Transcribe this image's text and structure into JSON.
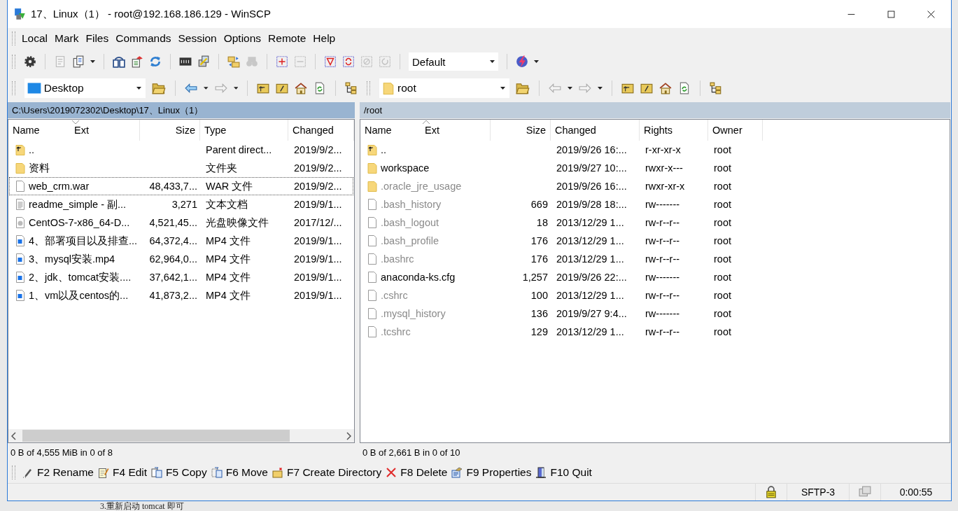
{
  "window": {
    "title": "17、Linux（1） - root@192.168.186.129 - WinSCP"
  },
  "menu": [
    "Local",
    "Mark",
    "Files",
    "Commands",
    "Session",
    "Options",
    "Remote",
    "Help"
  ],
  "toolbar": {
    "buttons": [
      {
        "kind": "gear",
        "disabled": false
      },
      {
        "kind": "notes",
        "disabled": true
      },
      {
        "kind": "clipboard",
        "disabled": false
      },
      {
        "kind": "compare",
        "disabled": false
      },
      {
        "kind": "synchronize",
        "disabled": false
      },
      {
        "kind": "refresh",
        "disabled": false
      },
      {
        "kind": "console",
        "disabled": false
      },
      {
        "kind": "putty",
        "disabled": false
      },
      {
        "kind": "explore",
        "disabled": false
      },
      {
        "kind": "find",
        "disabled": true
      },
      {
        "kind": "select",
        "disabled": false
      },
      {
        "kind": "unselect",
        "disabled": true
      },
      {
        "kind": "filter",
        "disabled": false
      },
      {
        "kind": "invert",
        "disabled": false
      },
      {
        "kind": "clear",
        "disabled": true
      },
      {
        "kind": "restore",
        "disabled": true
      }
    ],
    "transfer_preset": "Default"
  },
  "left_panel": {
    "location": {
      "label": "Desktop",
      "kind": "desktop"
    },
    "back_enabled": true,
    "active": true,
    "path": "C:\\Users\\2019072302\\Desktop\\17、Linux（1）",
    "columns": [
      {
        "label": "Name"
      },
      {
        "label": "Ext",
        "sort_ascending": false
      },
      {
        "label": "Size"
      },
      {
        "label": "Type"
      },
      {
        "label": "Changed"
      }
    ],
    "rows": [
      {
        "kind": "parent",
        "name": "..",
        "type": "Parent direct...",
        "changed": "2019/9/2...",
        "focused": false
      },
      {
        "kind": "folder",
        "name": "资料",
        "type": "文件夹",
        "changed": "2019/9/2...",
        "focused": false
      },
      {
        "kind": "file",
        "name": "web_crm.war",
        "size": "48,433,7...",
        "type": "WAR 文件",
        "changed": "2019/9/2...",
        "focused": true
      },
      {
        "kind": "text",
        "name": "readme_simple - 副...",
        "size": "3,271",
        "type": "文本文档",
        "changed": "2019/9/1...",
        "focused": false
      },
      {
        "kind": "disc",
        "name": "CentOS-7-x86_64-D...",
        "size": "4,521,45...",
        "type": "光盘映像文件",
        "changed": "2017/12/...",
        "focused": false
      },
      {
        "kind": "video",
        "name": "4、部署项目以及排查...",
        "size": "64,372,4...",
        "type": "MP4 文件",
        "changed": "2019/9/1...",
        "focused": false
      },
      {
        "kind": "video",
        "name": "3、mysql安装.mp4",
        "size": "62,964,0...",
        "type": "MP4 文件",
        "changed": "2019/9/1...",
        "focused": false
      },
      {
        "kind": "video",
        "name": "2、jdk、tomcat安装....",
        "size": "37,642,1...",
        "type": "MP4 文件",
        "changed": "2019/9/1...",
        "focused": false
      },
      {
        "kind": "video",
        "name": "1、vm以及centos的...",
        "size": "41,873,2...",
        "type": "MP4 文件",
        "changed": "2019/9/1...",
        "focused": false
      }
    ],
    "status": "0 B of 4,555 MiB in 0 of 8"
  },
  "right_panel": {
    "location": {
      "label": "root",
      "kind": "folder"
    },
    "back_enabled": false,
    "active": false,
    "path": "/root",
    "columns": [
      {
        "label": "Name"
      },
      {
        "label": "Ext",
        "sort_ascending": true
      },
      {
        "label": "Size"
      },
      {
        "label": "Changed"
      },
      {
        "label": "Rights"
      },
      {
        "label": "Owner"
      }
    ],
    "rows": [
      {
        "kind": "parent",
        "name": "..",
        "changed": "2019/9/26 16:...",
        "rights": "r-xr-xr-x",
        "owner": "root",
        "hidden": false
      },
      {
        "kind": "folder",
        "name": "workspace",
        "changed": "2019/9/27 10:...",
        "rights": "rwxr-x---",
        "owner": "root",
        "hidden": false
      },
      {
        "kind": "folder",
        "name": ".oracle_jre_usage",
        "changed": "2019/9/26 16:...",
        "rights": "rwxr-xr-x",
        "owner": "root",
        "hidden": true
      },
      {
        "kind": "file",
        "name": ".bash_history",
        "size": "669",
        "changed": "2019/9/28 18:...",
        "rights": "rw-------",
        "owner": "root",
        "hidden": true
      },
      {
        "kind": "file",
        "name": ".bash_logout",
        "size": "18",
        "changed": "2013/12/29 1...",
        "rights": "rw-r--r--",
        "owner": "root",
        "hidden": true
      },
      {
        "kind": "file",
        "name": ".bash_profile",
        "size": "176",
        "changed": "2013/12/29 1...",
        "rights": "rw-r--r--",
        "owner": "root",
        "hidden": true
      },
      {
        "kind": "file",
        "name": ".bashrc",
        "size": "176",
        "changed": "2013/12/29 1...",
        "rights": "rw-r--r--",
        "owner": "root",
        "hidden": true
      },
      {
        "kind": "file",
        "name": "anaconda-ks.cfg",
        "size": "1,257",
        "changed": "2019/9/26 22:...",
        "rights": "rw-------",
        "owner": "root",
        "hidden": false
      },
      {
        "kind": "file",
        "name": ".cshrc",
        "size": "100",
        "changed": "2013/12/29 1...",
        "rights": "rw-r--r--",
        "owner": "root",
        "hidden": true
      },
      {
        "kind": "file",
        "name": ".mysql_history",
        "size": "136",
        "changed": "2019/9/27 9:4...",
        "rights": "rw-------",
        "owner": "root",
        "hidden": true
      },
      {
        "kind": "file",
        "name": ".tcshrc",
        "size": "129",
        "changed": "2013/12/29 1...",
        "rights": "rw-r--r--",
        "owner": "root",
        "hidden": true
      }
    ],
    "status": "0 B of 2,661 B in 0 of 10"
  },
  "commands": [
    {
      "kind": "rename",
      "label": "F2 Rename"
    },
    {
      "kind": "edit",
      "label": "F4 Edit"
    },
    {
      "kind": "copy",
      "label": "F5 Copy"
    },
    {
      "kind": "move",
      "label": "F6 Move"
    },
    {
      "kind": "mkdir",
      "label": "F7 Create Directory"
    },
    {
      "kind": "delete",
      "label": "F8 Delete"
    },
    {
      "kind": "properties",
      "label": "F9 Properties"
    },
    {
      "kind": "quit",
      "label": "F10 Quit"
    }
  ],
  "status_bar": {
    "protocol": "SFTP-3",
    "elapsed": "0:00:55"
  },
  "background": {
    "document_text": "3.重新启动 tomcat 即可"
  }
}
